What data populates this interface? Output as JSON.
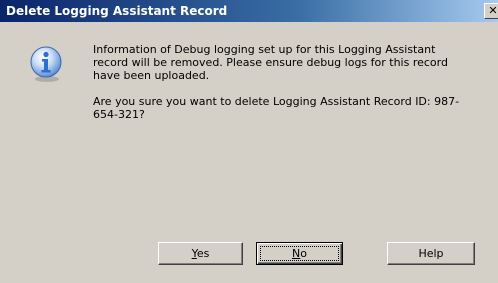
{
  "window": {
    "title": "Delete Logging Assistant Record",
    "close_glyph": "✕"
  },
  "message": {
    "paragraph1": "Information of Debug logging set up for this Logging Assistant record will be removed. Please ensure debug logs for this record have been uploaded.",
    "paragraph2": "Are you sure you want to delete Logging Assistant Record ID: 987-654-321?"
  },
  "icons": {
    "message_icon": "information-icon",
    "close_icon": "close-icon"
  },
  "buttons": {
    "yes_prefix": "",
    "yes_mnemonic": "Y",
    "yes_rest": "es",
    "no_prefix": "",
    "no_mnemonic": "N",
    "no_rest": "o",
    "help_label": "Help"
  },
  "colors": {
    "titlebar_start": "#0a246a",
    "titlebar_end": "#a6caf0",
    "dialog_background": "#d4d0c8",
    "info_icon_blue": "#2a6fd1"
  }
}
